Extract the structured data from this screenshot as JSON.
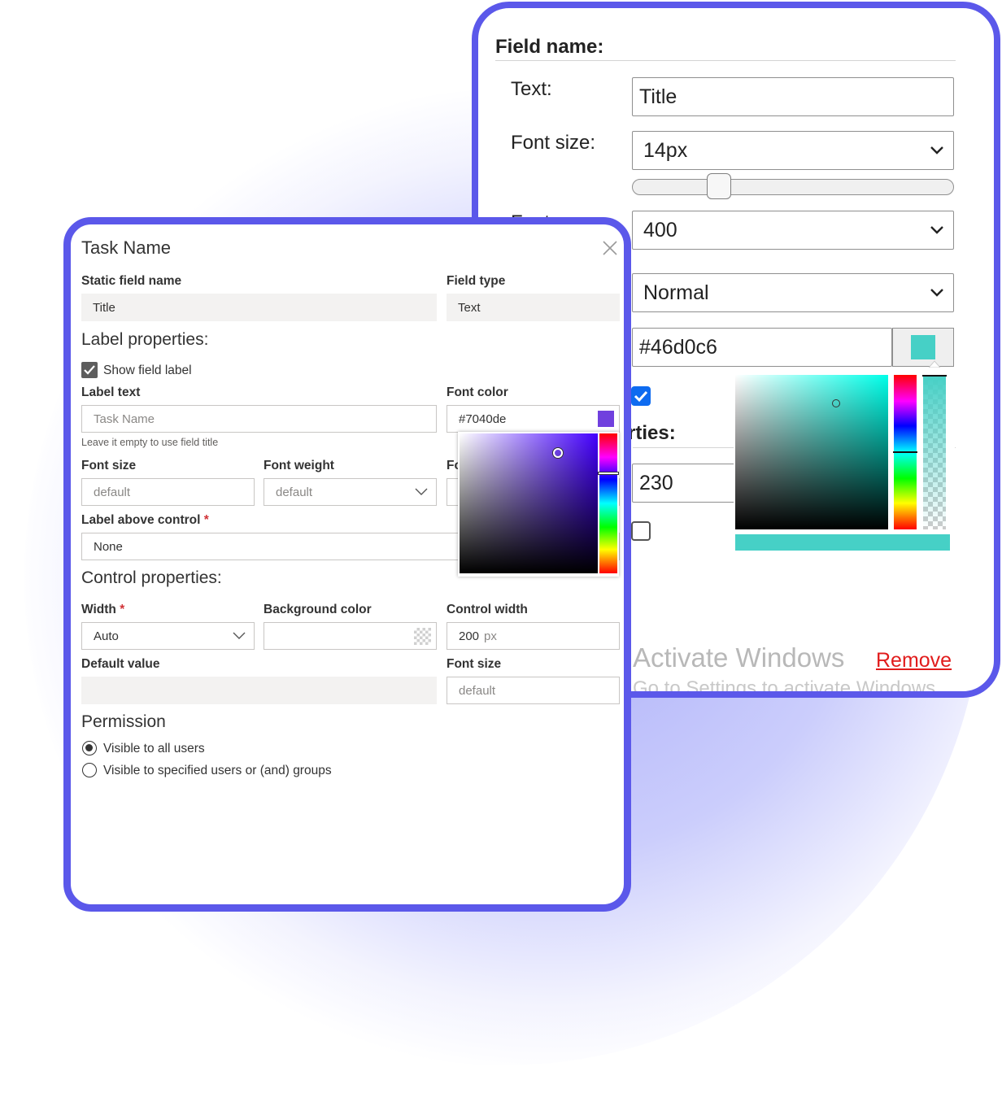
{
  "colors": {
    "accent_border": "#5b58ea",
    "label_color_value": "#7040de",
    "label_color_hue": "#4400ff",
    "field_color_value": "#46d0c6",
    "field_color_hue": "#00ffe9"
  },
  "back_panel": {
    "section_title": "Field name:",
    "text_label": "Text:",
    "text_value": "Title",
    "font_size_label": "Font size:",
    "font_size_value": "14px",
    "font_size_slider_fraction": 0.27,
    "font_weight_label_partial": "Font",
    "font_weight_value": "400",
    "font_style_value": "Normal",
    "color_value": "#46d0c6",
    "visible_checked": true,
    "properties_heading_partial": "rties:",
    "width_value": "230",
    "second_checkbox_checked": false,
    "watermark_title": "Activate Windows",
    "watermark_subtitle": "Go to Settings to activate Windows.",
    "remove_label": "Remove"
  },
  "dialog": {
    "title": "Task Name",
    "static_field_name_label": "Static field name",
    "static_field_name_value": "Title",
    "field_type_label": "Field type",
    "field_type_value": "Text",
    "label_properties_heading": "Label properties:",
    "show_field_label_text": "Show field label",
    "show_field_label_checked": true,
    "label_text_label": "Label text",
    "label_text_placeholder": "Task Name",
    "label_text_hint": "Leave it empty to use field title",
    "font_color_label": "Font color",
    "font_color_value": "#7040de",
    "font_size_label": "Font size",
    "font_size_placeholder": "default",
    "font_weight_label": "Font weight",
    "font_weight_value": "default",
    "font_style_label_partial": "Fo",
    "label_above_control_label": "Label above control",
    "required_marker": "*",
    "label_above_control_value": "None",
    "control_properties_heading": "Control properties:",
    "width_label": "Width",
    "width_value": "Auto",
    "background_color_label": "Background color",
    "control_width_label": "Control width",
    "control_width_value": "200",
    "control_width_unit": "px",
    "default_value_label": "Default value",
    "control_font_size_label": "Font size",
    "control_font_size_placeholder": "default",
    "permission_heading": "Permission",
    "permission_options": [
      {
        "label": "Visible to all users",
        "selected": true
      },
      {
        "label": "Visible to specified users or (and) groups",
        "selected": false
      }
    ]
  },
  "icons": [
    "close-icon",
    "chevron-down-icon",
    "checkmark-icon",
    "transparent-swatch-icon"
  ]
}
